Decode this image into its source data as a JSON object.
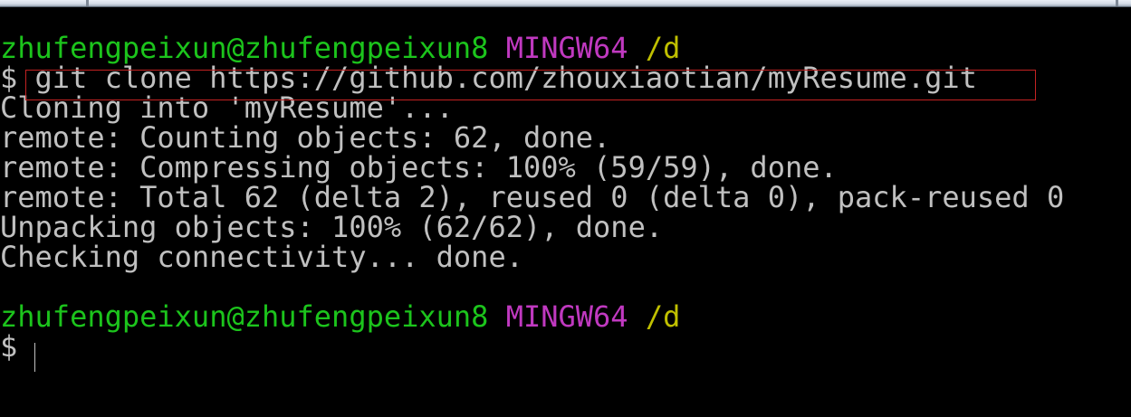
{
  "prompt1": {
    "user_host": "zhufengpeixun@zhufengpeixun8",
    "system": "MINGW64",
    "path": "/d"
  },
  "command_line": {
    "symbol": "$",
    "command": "git clone https://github.com/zhouxiaotian/myResume.git"
  },
  "output": [
    "Cloning into 'myResume'...",
    "remote: Counting objects: 62, done.",
    "remote: Compressing objects: 100% (59/59), done.",
    "remote: Total 62 (delta 2), reused 0 (delta 0), pack-reused 0",
    "Unpacking objects: 100% (62/62), done.",
    "Checking connectivity... done."
  ],
  "prompt2": {
    "user_host": "zhufengpeixun@zhufengpeixun8",
    "system": "MINGW64",
    "path": "/d"
  },
  "input_line": {
    "symbol": "$",
    "value": ""
  },
  "colors": {
    "background": "#000000",
    "user_host": "#1cc41c",
    "system": "#c039c0",
    "path": "#c0c000",
    "text": "#c0c0c0",
    "highlight_border": "#c32222"
  }
}
